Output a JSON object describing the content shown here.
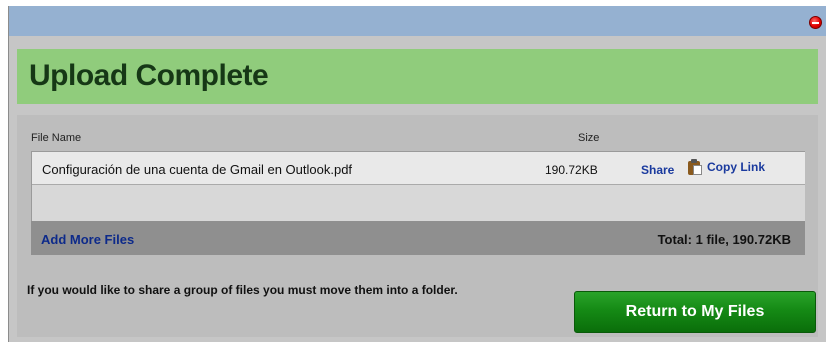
{
  "dialog": {
    "header_title": "Upload Complete"
  },
  "table": {
    "columns": [
      "File Name",
      "Size"
    ],
    "rows": [
      {
        "file_name": "Configuración de una cuenta de Gmail en Outlook.pdf",
        "size": "190.72KB",
        "share_label": "Share",
        "copy_link_label": "Copy Link"
      }
    ]
  },
  "footer": {
    "add_more_label": "Add More Files",
    "total": "Total: 1 file, 190.72KB"
  },
  "info_text": "If you would like to share a group of files you must move them into a folder.",
  "return_button_label": "Return to My Files",
  "icons": {
    "close": "close-icon",
    "copy": "clipboard-icon"
  },
  "colors": {
    "titlebar": "#95b1d1",
    "header_band": "#90cc7c",
    "button_green": "#158a15",
    "link_blue": "#1a3a9e"
  }
}
